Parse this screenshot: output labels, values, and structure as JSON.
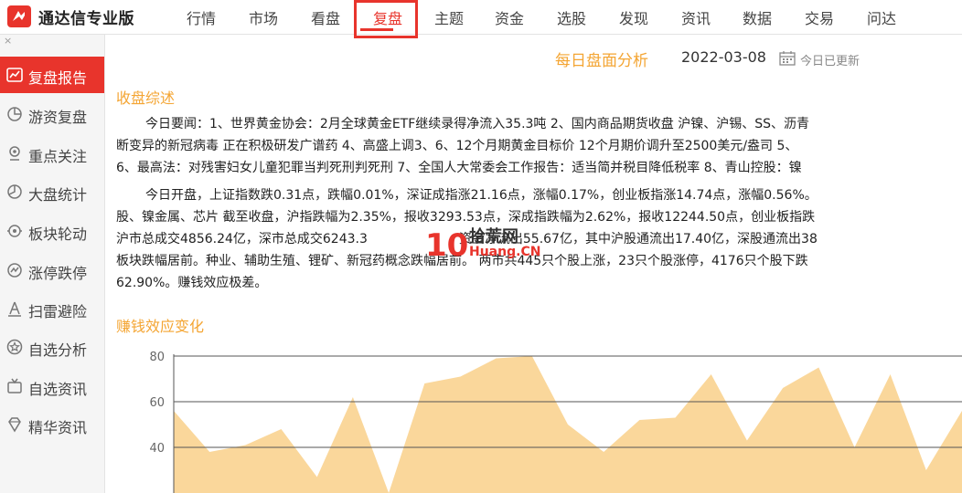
{
  "app": {
    "title": "通达信专业版"
  },
  "nav": {
    "items": [
      "行情",
      "市场",
      "看盘",
      "复盘",
      "主题",
      "资金",
      "选股",
      "发现",
      "资讯",
      "数据",
      "交易",
      "问达"
    ],
    "active": "复盘"
  },
  "sidebar": {
    "close": "×",
    "items": [
      {
        "label": "复盘报告",
        "icon": "report-icon"
      },
      {
        "label": "游资复盘",
        "icon": "pie-icon"
      },
      {
        "label": "重点关注",
        "icon": "focus-icon"
      },
      {
        "label": "大盘统计",
        "icon": "pie-chart-icon"
      },
      {
        "label": "板块轮动",
        "icon": "rotate-icon"
      },
      {
        "label": "涨停跌停",
        "icon": "limit-icon"
      },
      {
        "label": "扫雷避险",
        "icon": "triangle-a-icon"
      },
      {
        "label": "自选分析",
        "icon": "star-icon"
      },
      {
        "label": "自选资讯",
        "icon": "tv-icon"
      },
      {
        "label": "精华资讯",
        "icon": "diamond-icon"
      }
    ]
  },
  "report": {
    "title": "每日盘面分析",
    "date": "2022-03-08",
    "status": "今日已更新"
  },
  "summary": {
    "title": "收盘综述",
    "news_lines": [
      "今日要闻：1、世界黄金协会：2月全球黄金ETF继续录得净流入35.3吨 2、国内商品期货收盘 沪镍、沪锡、SS、沥青",
      "断变异的新冠病毒 正在积极研发广谱药 4、高盛上调3、6、12个月期黄金目标价 12个月期价调升至2500美元/盎司 5、",
      "6、最高法：对残害妇女儿童犯罪当判死刑判死刑 7、全国人大常委会工作报告：适当简并税目降低税率 8、青山控股：镍"
    ],
    "open_lines": [
      "今日开盘，上证指数跌0.31点，跌幅0.01%，深证成指涨21.16点，涨幅0.17%，创业板指涨14.74点，涨幅0.56%。",
      "股、镍金属、芯片 截至收盘，沪指跌幅为2.35%，报收3293.53点，深成指跌幅为2.62%，报收12244.50点，创业板指跌",
      "沪市总成交4856.24亿，深市总成交6243.3",
      "板块跌幅居前。种业、辅助生殖、锂矿、新冠药概念跌幅居前。 两市共445只个股上涨，23只个股涨停，4176只个股下跌",
      "62.90%。赚钱效应极差。"
    ],
    "open_line3_tail": "资金净流出55.67亿，其中沪股通流出17.40亿，深股通流出38"
  },
  "watermark": {
    "text1": "拾荒网",
    "text2": "Huang.CN",
    "logo": "10"
  },
  "chart_section": {
    "title": "赚钱效应变化"
  },
  "chart_data": {
    "type": "area",
    "title": "",
    "ylim": [
      20,
      80
    ],
    "yticks": [
      80,
      60,
      40
    ],
    "grid": true,
    "color": "#fad79b",
    "values": [
      56,
      38,
      41,
      48,
      27,
      62,
      20,
      68,
      71,
      79,
      80,
      50,
      38,
      52,
      53,
      72,
      43,
      66,
      75,
      40,
      72,
      30,
      56
    ]
  }
}
